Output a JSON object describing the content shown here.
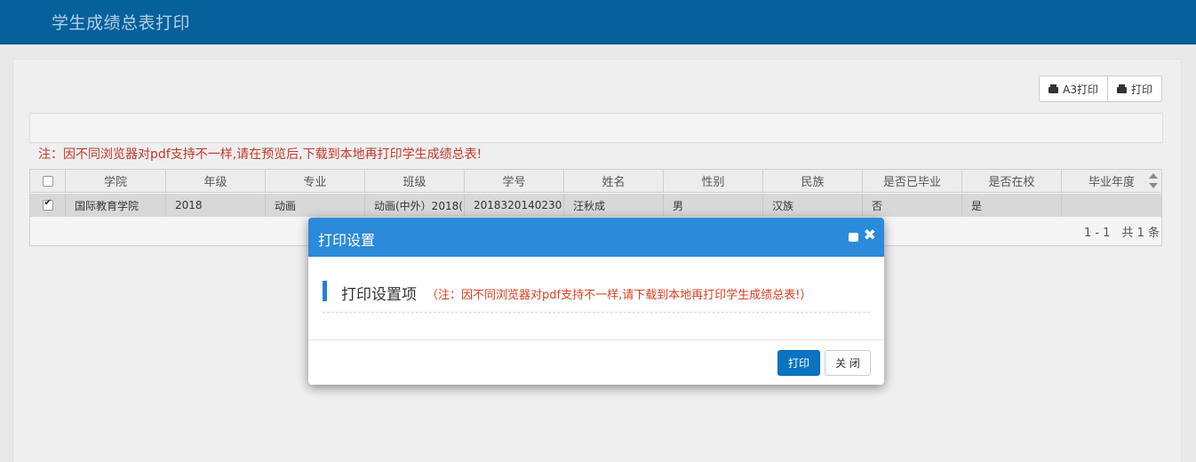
{
  "header": {
    "title": "学生成绩总表打印"
  },
  "toolbar": {
    "a3_print_label": "A3打印",
    "print_label": "打印"
  },
  "notice": "注：因不同浏览器对pdf支持不一样,请在预览后,下载到本地再打印学生成绩总表!",
  "grid": {
    "columns": [
      "学院",
      "年级",
      "专业",
      "班级",
      "学号",
      "姓名",
      "性别",
      "民族",
      "是否已毕业",
      "是否在校",
      "毕业年度"
    ],
    "rows": [
      {
        "checked": true,
        "cells": [
          "国际教育学院",
          "2018",
          "动画",
          "动画(中外）2018(",
          "2018320140230",
          "汪秋成",
          "男",
          "汉族",
          "否",
          "是",
          ""
        ]
      }
    ],
    "pager": "1 - 1　共 1 条"
  },
  "modal": {
    "title": "打印设置",
    "section_label": "打印设置项",
    "section_note": "（注：因不同浏览器对pdf支持不一样,请下载到本地再打印学生成绩总表!）",
    "print_button": "打印",
    "close_button": "关 闭"
  },
  "colors": {
    "topbar": "#05609c",
    "modal_header": "#2b8ad9",
    "notice_red": "#c1392b",
    "primary_button": "#0b74c2"
  }
}
